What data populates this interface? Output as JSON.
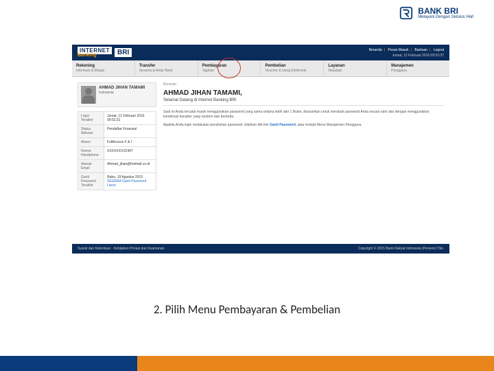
{
  "brand": {
    "name": "BANK BRI",
    "tagline": "Melayani Dengan Setulus Hati"
  },
  "header": {
    "logo_internet": "INTERNET",
    "logo_banking": "Banking",
    "logo_bri": "BRI",
    "links": {
      "home": "Beranda",
      "inbox": "Pesan Masuk",
      "help": "Bantuan",
      "logout": "Logout"
    },
    "datetime": "Jumat, 12 Februari 2016 09:53:37"
  },
  "nav": [
    {
      "title": "Rekening",
      "sub": "Informasi & Mutasi"
    },
    {
      "title": "Transfer",
      "sub": "Sesama & Antar Bank"
    },
    {
      "title": "Pembayaran",
      "sub": "Tagihan"
    },
    {
      "title": "Pembelian",
      "sub": "Voucher & Uang Elektronik"
    },
    {
      "title": "Layanan",
      "sub": "Nasabah"
    },
    {
      "title": "Manajemen",
      "sub": "Pengguna"
    }
  ],
  "user": {
    "name": "AHMAD JIHAN TAMAMI",
    "country": "Indonesia",
    "rows": [
      {
        "label": "Login Terakhir",
        "value": "Jumat, 12 Februari 2016 09:52:31"
      },
      {
        "label": "Status Aktivasi",
        "value": "Pendaftar Finansial"
      },
      {
        "label": "Akses",
        "value": "FullAccess F & I"
      },
      {
        "label": "Nomor Handphone",
        "value": "XXXXXXXX2407"
      },
      {
        "label": "Alamat Email",
        "value": "Ahmad_jihan@hotmail.co.id"
      },
      {
        "label": "Ganti Password Terakhir",
        "value": "Rabu, 19 Agustus 2015",
        "link": "SEGERA Ganti Password Lama"
      }
    ]
  },
  "main": {
    "breadcrumb": "Beranda",
    "hello": "AHMAD JIHAN TAMAMI,",
    "welcome": "Selamat Datang di Internet Banking BRI",
    "p1": "Saat ini Anda tercatat masih menggunakan password yang sama selama lebih dari 1 Bulan, disarankan untuk merubah password Anda secara rutin dan dengan menggunakan kombinasi karakter yang random dan berbeda.",
    "p2a": "Apabila Anda ingin melakukan perubahan password, silahkan klik link ",
    "p2link": "Ganti Password",
    "p2b": ", atau melalui Menu Manajemen Pengguna."
  },
  "footer": {
    "left": "Syarat dan Ketentuan · Kebijakan Privasi dan Keamanan",
    "right": "Copyright © 2015 Bank Rakyat Indonesia (Persero) Tbk."
  },
  "caption": "2. Pilih Menu Pembayaran & Pembelian"
}
